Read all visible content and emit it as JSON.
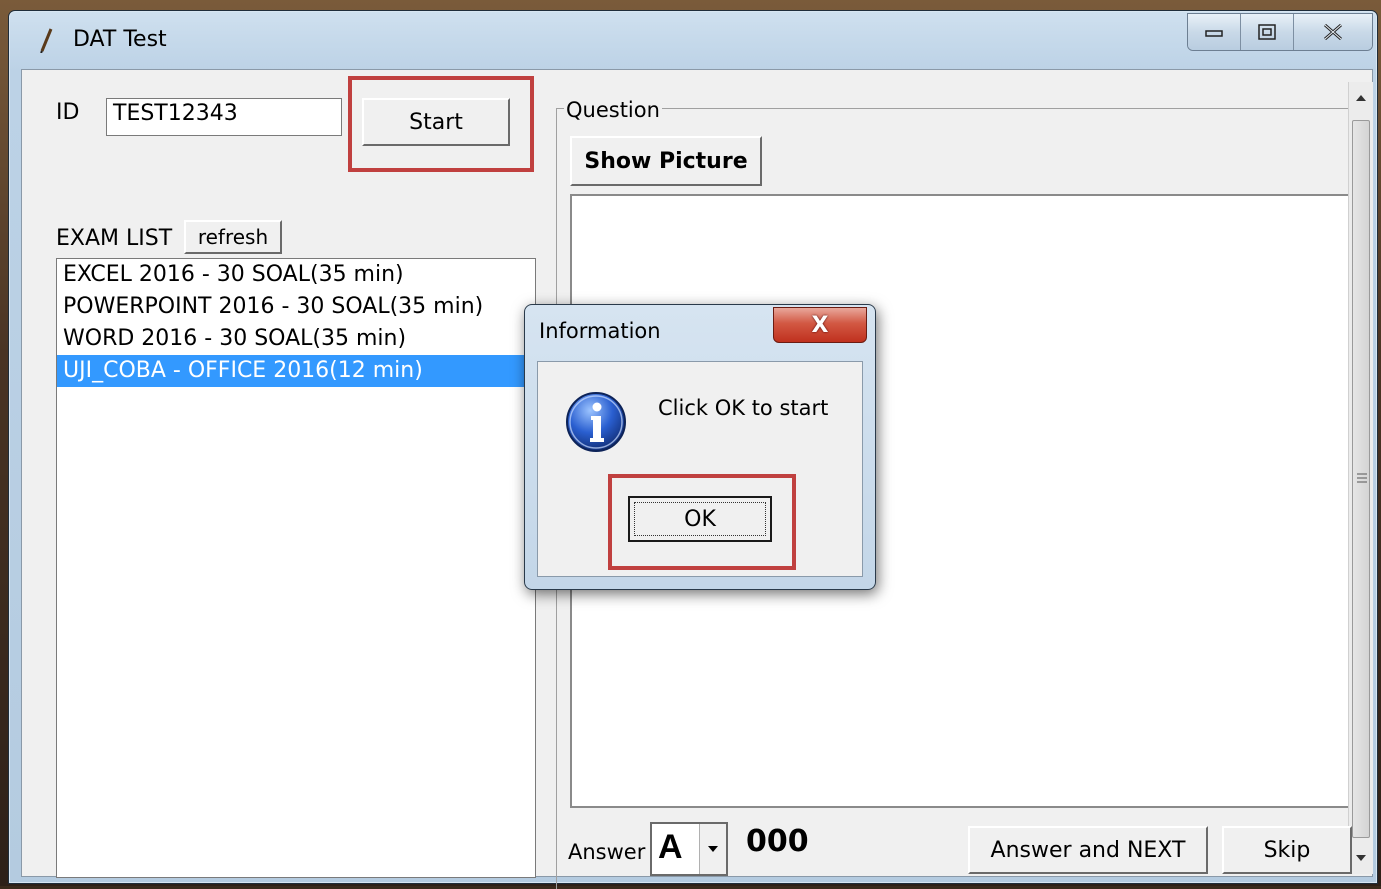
{
  "window": {
    "title": "DAT Test"
  },
  "form": {
    "id_label": "ID",
    "id_value": "TEST12343",
    "start_label": "Start",
    "exam_list_label": "EXAM LIST",
    "refresh_label": "refresh",
    "exam_items": [
      "EXCEL 2016 - 30 SOAL(35 min)",
      "POWERPOINT 2016 - 30 SOAL(35 min)",
      "WORD 2016 - 30 SOAL(35 min)",
      "UJI_COBA - OFFICE 2016(12 min)"
    ],
    "selected_index": 3
  },
  "question": {
    "group_label": "Question",
    "show_picture_label": "Show Picture",
    "answer_label": "Answer",
    "answer_value": "A",
    "counter": "000",
    "answer_next_label": "Answer and NEXT",
    "skip_label": "Skip"
  },
  "dialog": {
    "title": "Information",
    "close_glyph": "X",
    "message": "Click OK to start",
    "ok_label": "OK"
  },
  "colors": {
    "highlight_box": "#c0403f",
    "selection": "#3399ff"
  }
}
